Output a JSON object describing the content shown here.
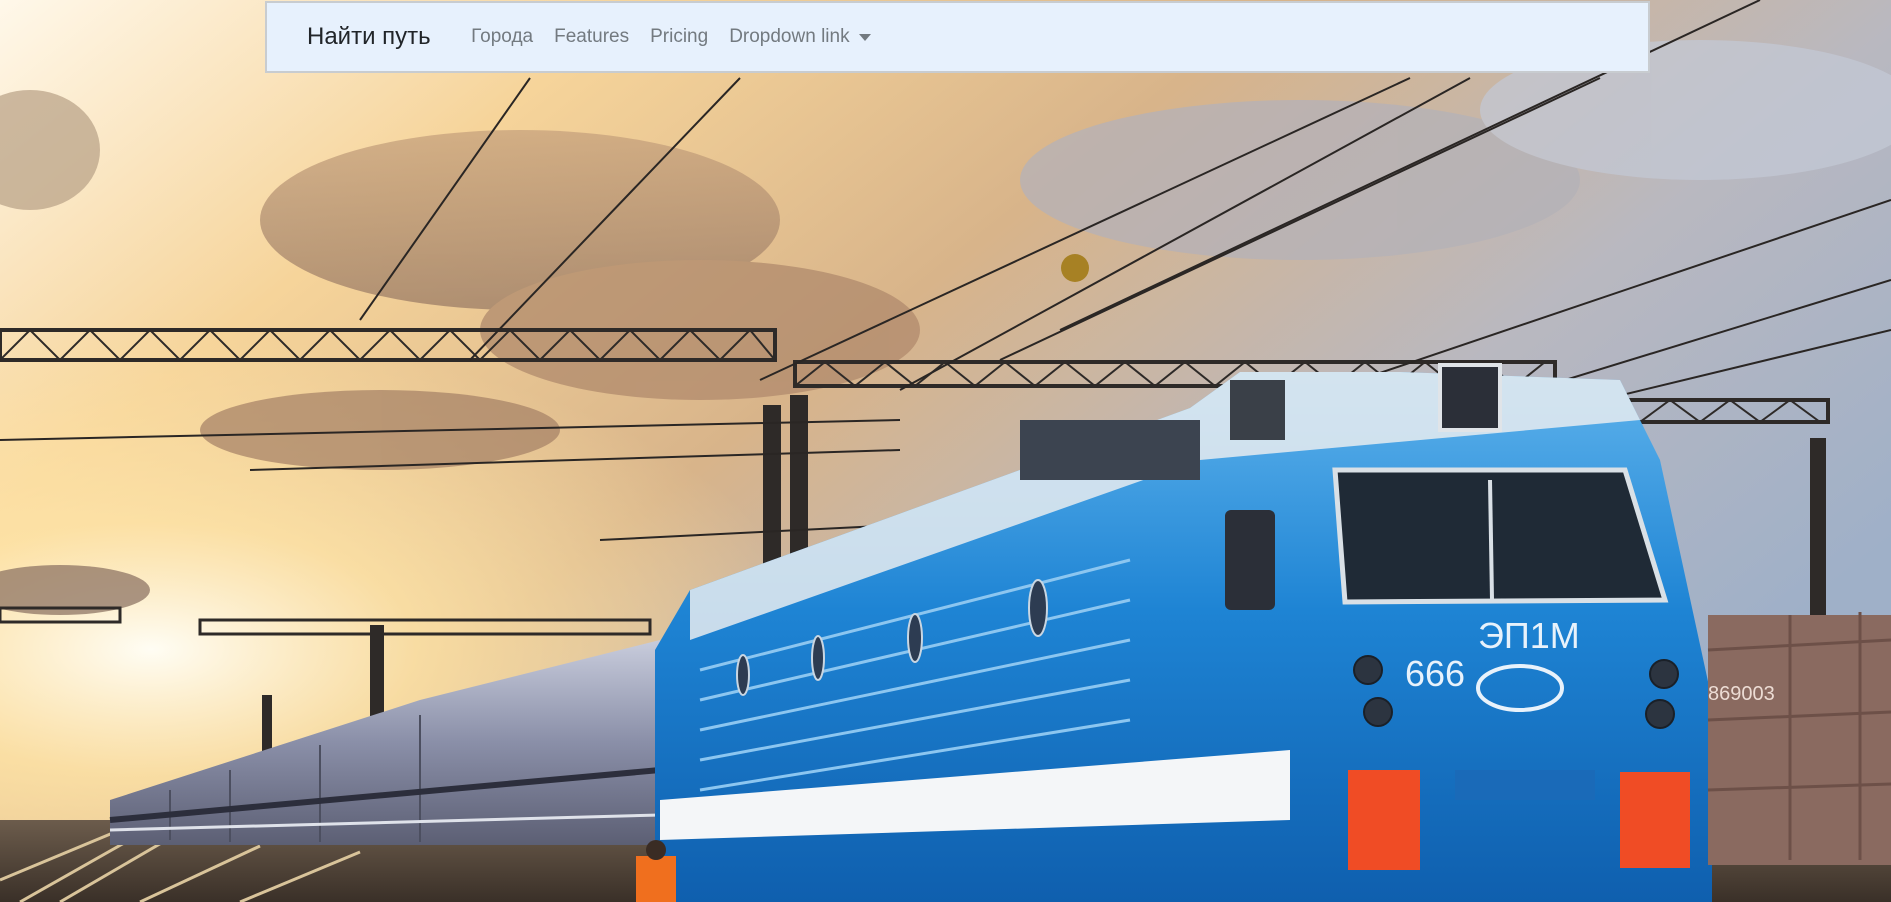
{
  "navbar": {
    "brand": "Найти путь",
    "links": [
      {
        "label": "Города"
      },
      {
        "label": "Features"
      },
      {
        "label": "Pricing"
      },
      {
        "label": "Dropdown link",
        "icon": "caret-down-icon"
      }
    ]
  },
  "hero": {
    "subject": "blue electric locomotive hauling passenger train under catenary wires at sunset",
    "locomotive_marking": "ЭП1М",
    "locomotive_number": "666",
    "colors": {
      "locomotive": "#1e84d4",
      "sky_warm": "#f5c27a",
      "sky_cool": "#a9b4c6"
    }
  },
  "colors": {
    "navbar_bg": "#e7f1fd",
    "navbar_border": "#c8ccd0",
    "brand_text": "#212529",
    "link_text": "#737a80"
  }
}
